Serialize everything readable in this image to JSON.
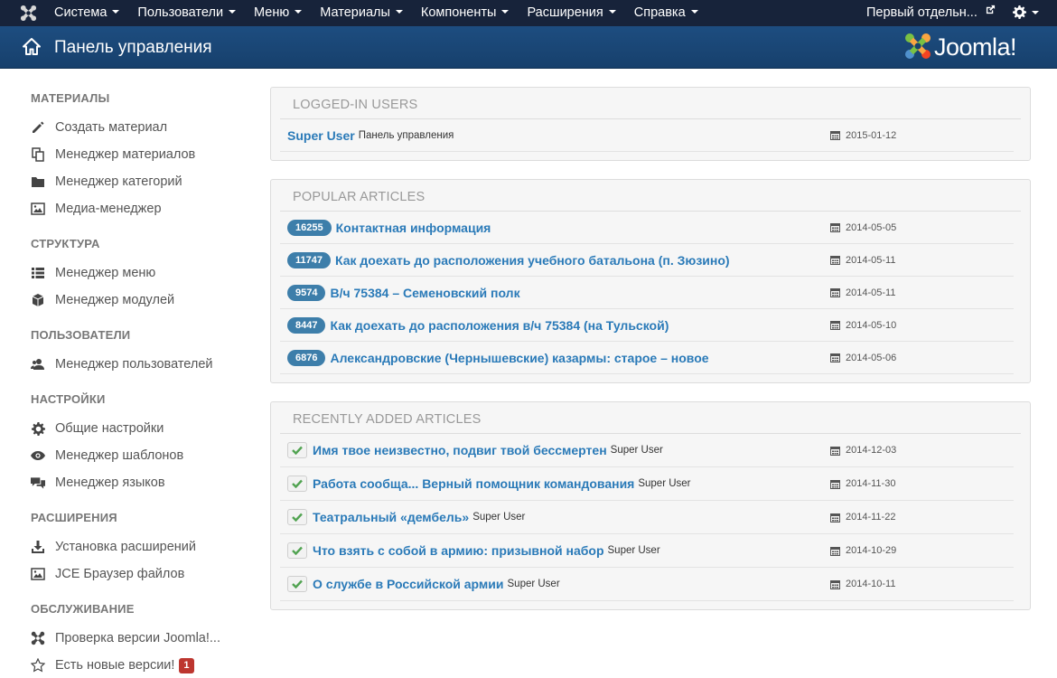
{
  "topnav": {
    "items": [
      "Система",
      "Пользователи",
      "Меню",
      "Материалы",
      "Компоненты",
      "Расширения",
      "Справка"
    ],
    "site_link": "Первый отдельн..."
  },
  "header": {
    "title": "Панель управления",
    "brand": "Joomla!"
  },
  "sidebar": {
    "sections": [
      {
        "title": "МАТЕРИАЛЫ",
        "items": [
          {
            "label": "Создать материал",
            "icon": "pencil-icon"
          },
          {
            "label": "Менеджер материалов",
            "icon": "copy-icon"
          },
          {
            "label": "Менеджер категорий",
            "icon": "folder-icon"
          },
          {
            "label": "Медиа-менеджер",
            "icon": "picture-icon"
          }
        ]
      },
      {
        "title": "СТРУКТУРА",
        "items": [
          {
            "label": "Менеджер меню",
            "icon": "list-icon"
          },
          {
            "label": "Менеджер модулей",
            "icon": "cube-icon"
          }
        ]
      },
      {
        "title": "ПОЛЬЗОВАТЕЛИ",
        "items": [
          {
            "label": "Менеджер пользователей",
            "icon": "users-icon"
          }
        ]
      },
      {
        "title": "НАСТРОЙКИ",
        "items": [
          {
            "label": "Общие настройки",
            "icon": "gear-icon"
          },
          {
            "label": "Менеджер шаблонов",
            "icon": "eye-icon"
          },
          {
            "label": "Менеджер языков",
            "icon": "comments-icon"
          }
        ]
      },
      {
        "title": "РАСШИРЕНИЯ",
        "items": [
          {
            "label": "Установка расширений",
            "icon": "download-icon"
          },
          {
            "label": "JCE Браузер файлов",
            "icon": "picture-icon"
          }
        ]
      },
      {
        "title": "ОБСЛУЖИВАНИЕ",
        "items": [
          {
            "label": "Проверка версии Joomla!...",
            "icon": "joomla-icon"
          },
          {
            "label": "Есть новые версии!",
            "icon": "star-icon",
            "badge": "1"
          }
        ]
      }
    ]
  },
  "logged_in": {
    "title": "LOGGED-IN USERS",
    "rows": [
      {
        "user": "Super User",
        "location": "Панель управления",
        "date": "2015-01-12"
      }
    ]
  },
  "popular": {
    "title": "POPULAR ARTICLES",
    "rows": [
      {
        "hits": "16255",
        "title": "Контактная информация",
        "date": "2014-05-05"
      },
      {
        "hits": "11747",
        "title": "Как доехать до расположения учебного батальона (п. Зюзино)",
        "date": "2014-05-11"
      },
      {
        "hits": "9574",
        "title": "В/ч 75384 – Семеновский полк",
        "date": "2014-05-11"
      },
      {
        "hits": "8447",
        "title": "Как доехать до расположения в/ч 75384 (на Тульской)",
        "date": "2014-05-10"
      },
      {
        "hits": "6876",
        "title": "Александровские (Чернышевские) казармы: старое – новое",
        "date": "2014-05-06"
      }
    ]
  },
  "recent": {
    "title": "RECENTLY ADDED ARTICLES",
    "rows": [
      {
        "title": "Имя твое неизвестно, подвиг твой бессмертен",
        "author": "Super User",
        "date": "2014-12-03"
      },
      {
        "title": "Работа сообща... Верный помощник командования",
        "author": "Super User",
        "date": "2014-11-30"
      },
      {
        "title": "Театральный «дембель»",
        "author": "Super User",
        "date": "2014-11-22"
      },
      {
        "title": "Что взять с собой в армию: призывной набор",
        "author": "Super User",
        "date": "2014-10-29"
      },
      {
        "title": "О службе в Российской армии",
        "author": "Super User",
        "date": "2014-10-11"
      }
    ]
  }
}
